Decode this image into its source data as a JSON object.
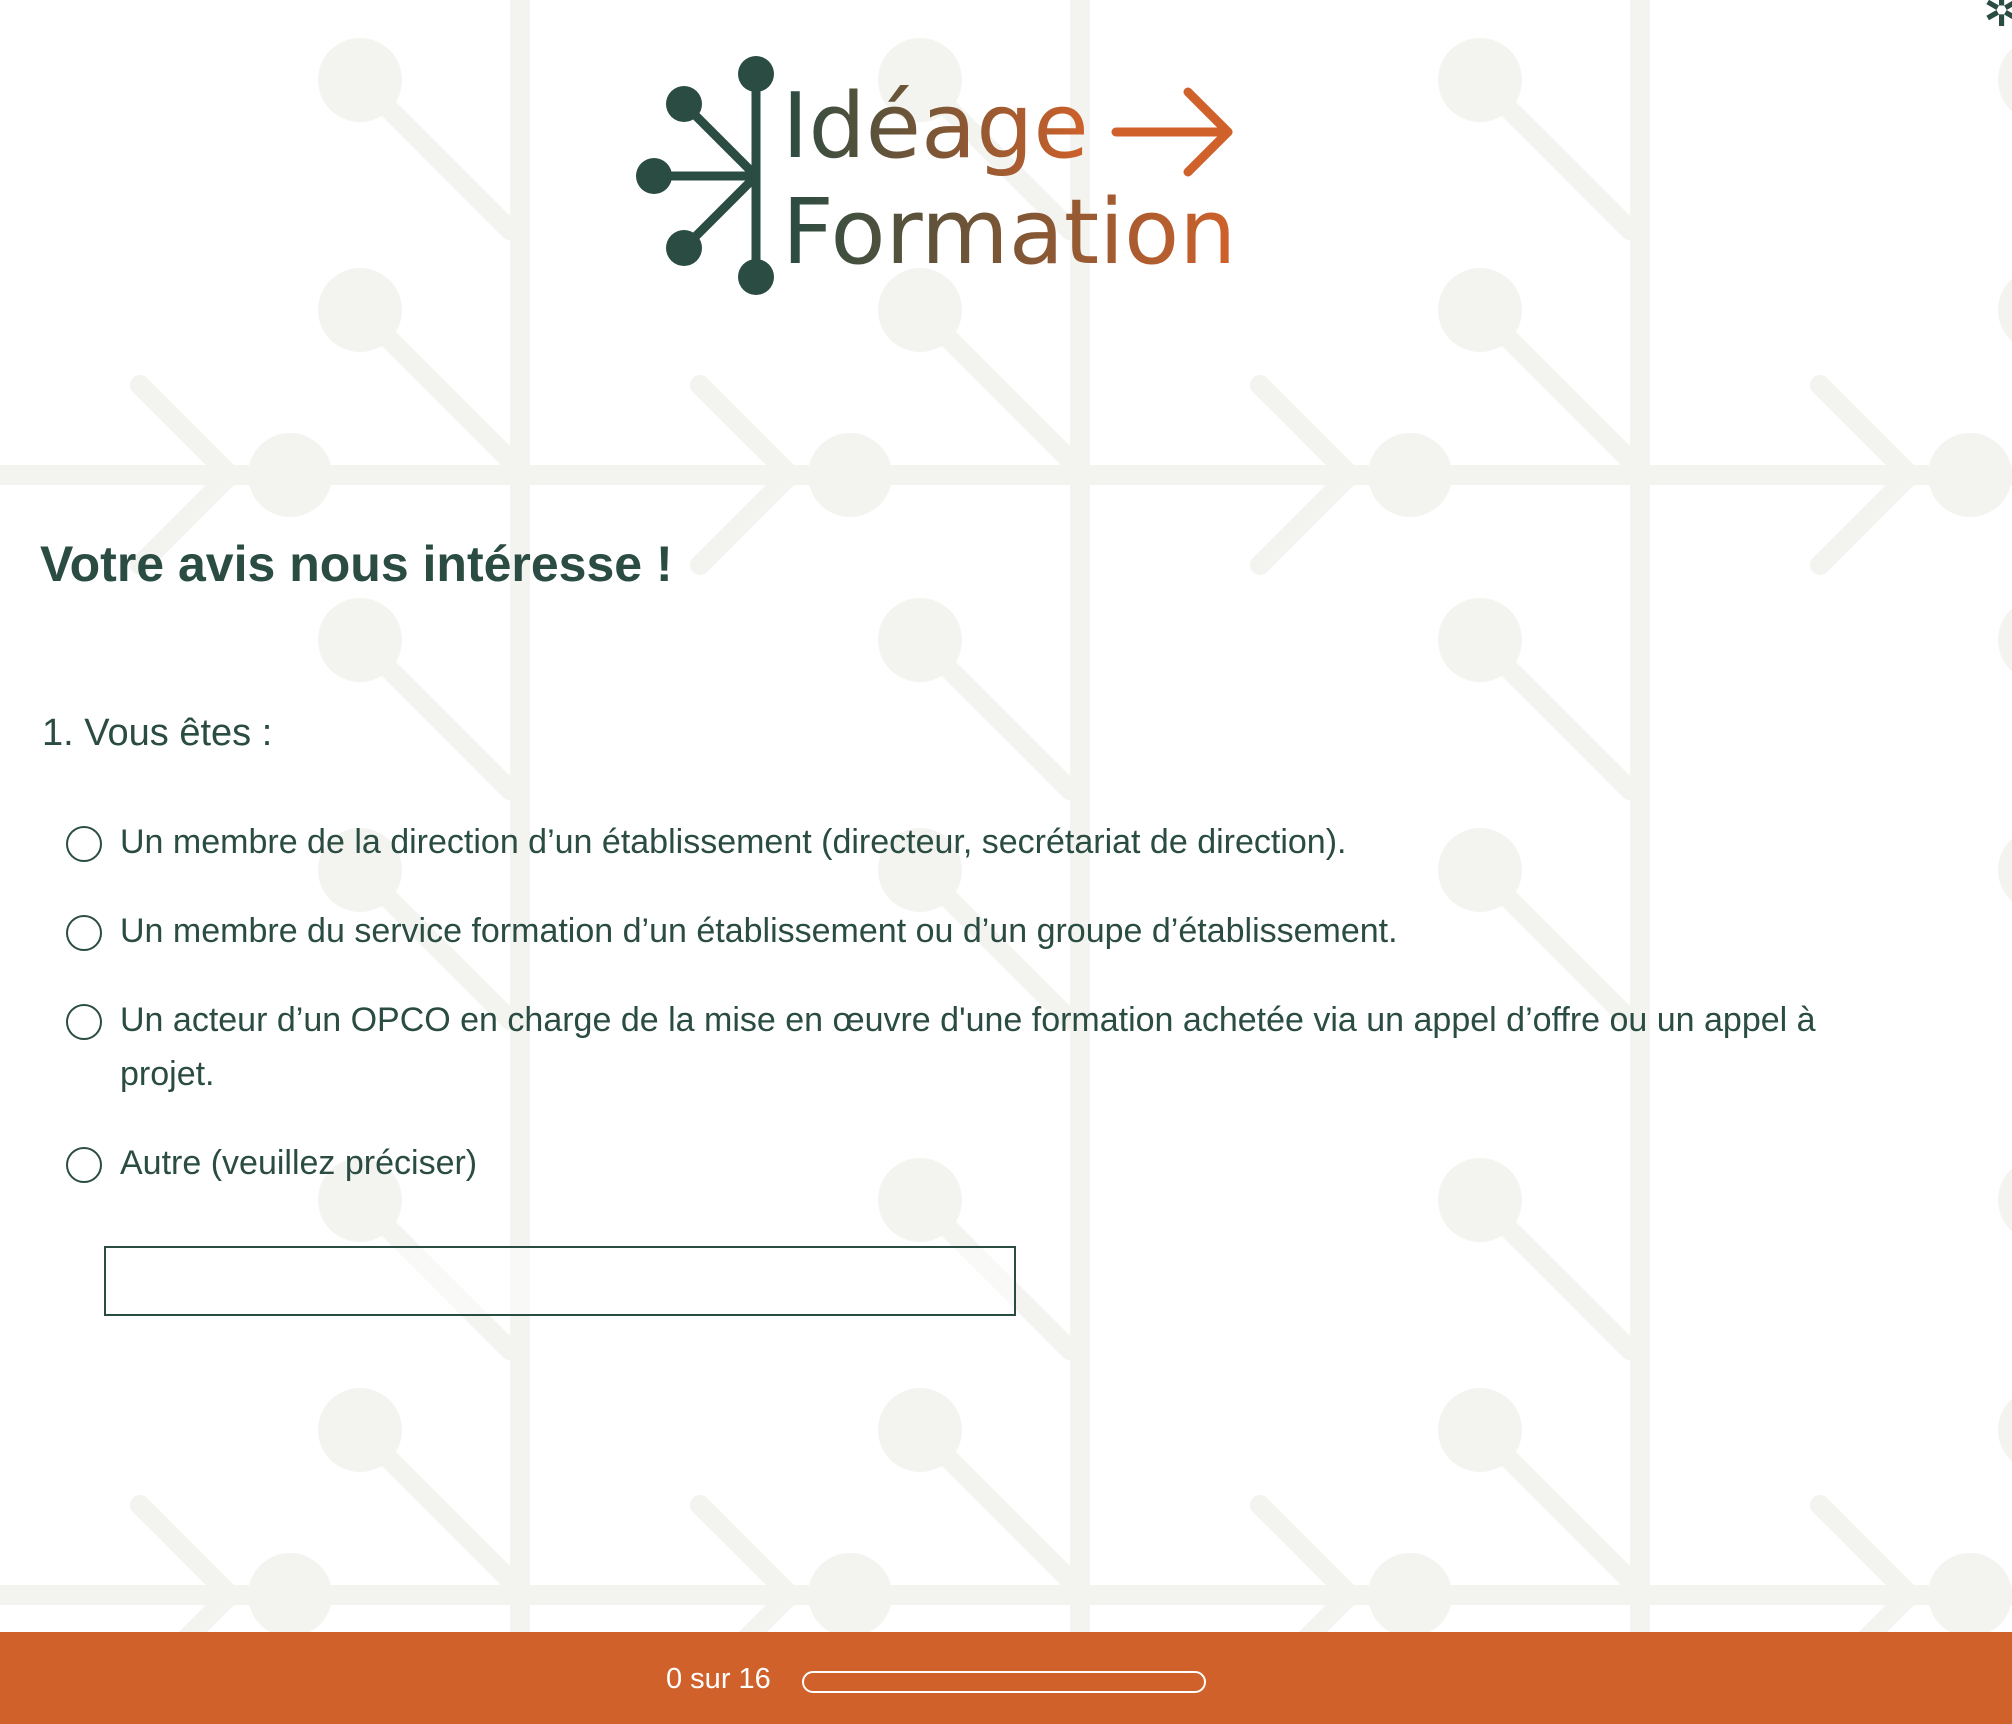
{
  "logo": {
    "line1": "Idéage",
    "line2": "Formation",
    "color_dark": "#2a4c42",
    "color_orange": "#d0612a"
  },
  "corner_icon": "star-icon",
  "survey": {
    "title": "Votre avis nous intéresse !",
    "question": "1. Vous êtes :",
    "options": [
      {
        "label": "Un membre de la direction d’un établissement (directeur, secrétariat de direction)."
      },
      {
        "label": "Un membre du service formation d’un établissement ou d’un groupe d’établissement."
      },
      {
        "label": "Un acteur d’un OPCO en charge de la mise en œuvre d'une formation achetée via un appel d’offre ou un appel à projet."
      },
      {
        "label": "Autre (veuillez préciser)"
      }
    ],
    "other_value": ""
  },
  "footer": {
    "progress_text": "0 sur 16",
    "progress_fraction": 0,
    "color": "#d0612a"
  },
  "colors": {
    "text": "#2a4c42",
    "accent": "#d0612a",
    "pattern": "#f3f3f0"
  }
}
